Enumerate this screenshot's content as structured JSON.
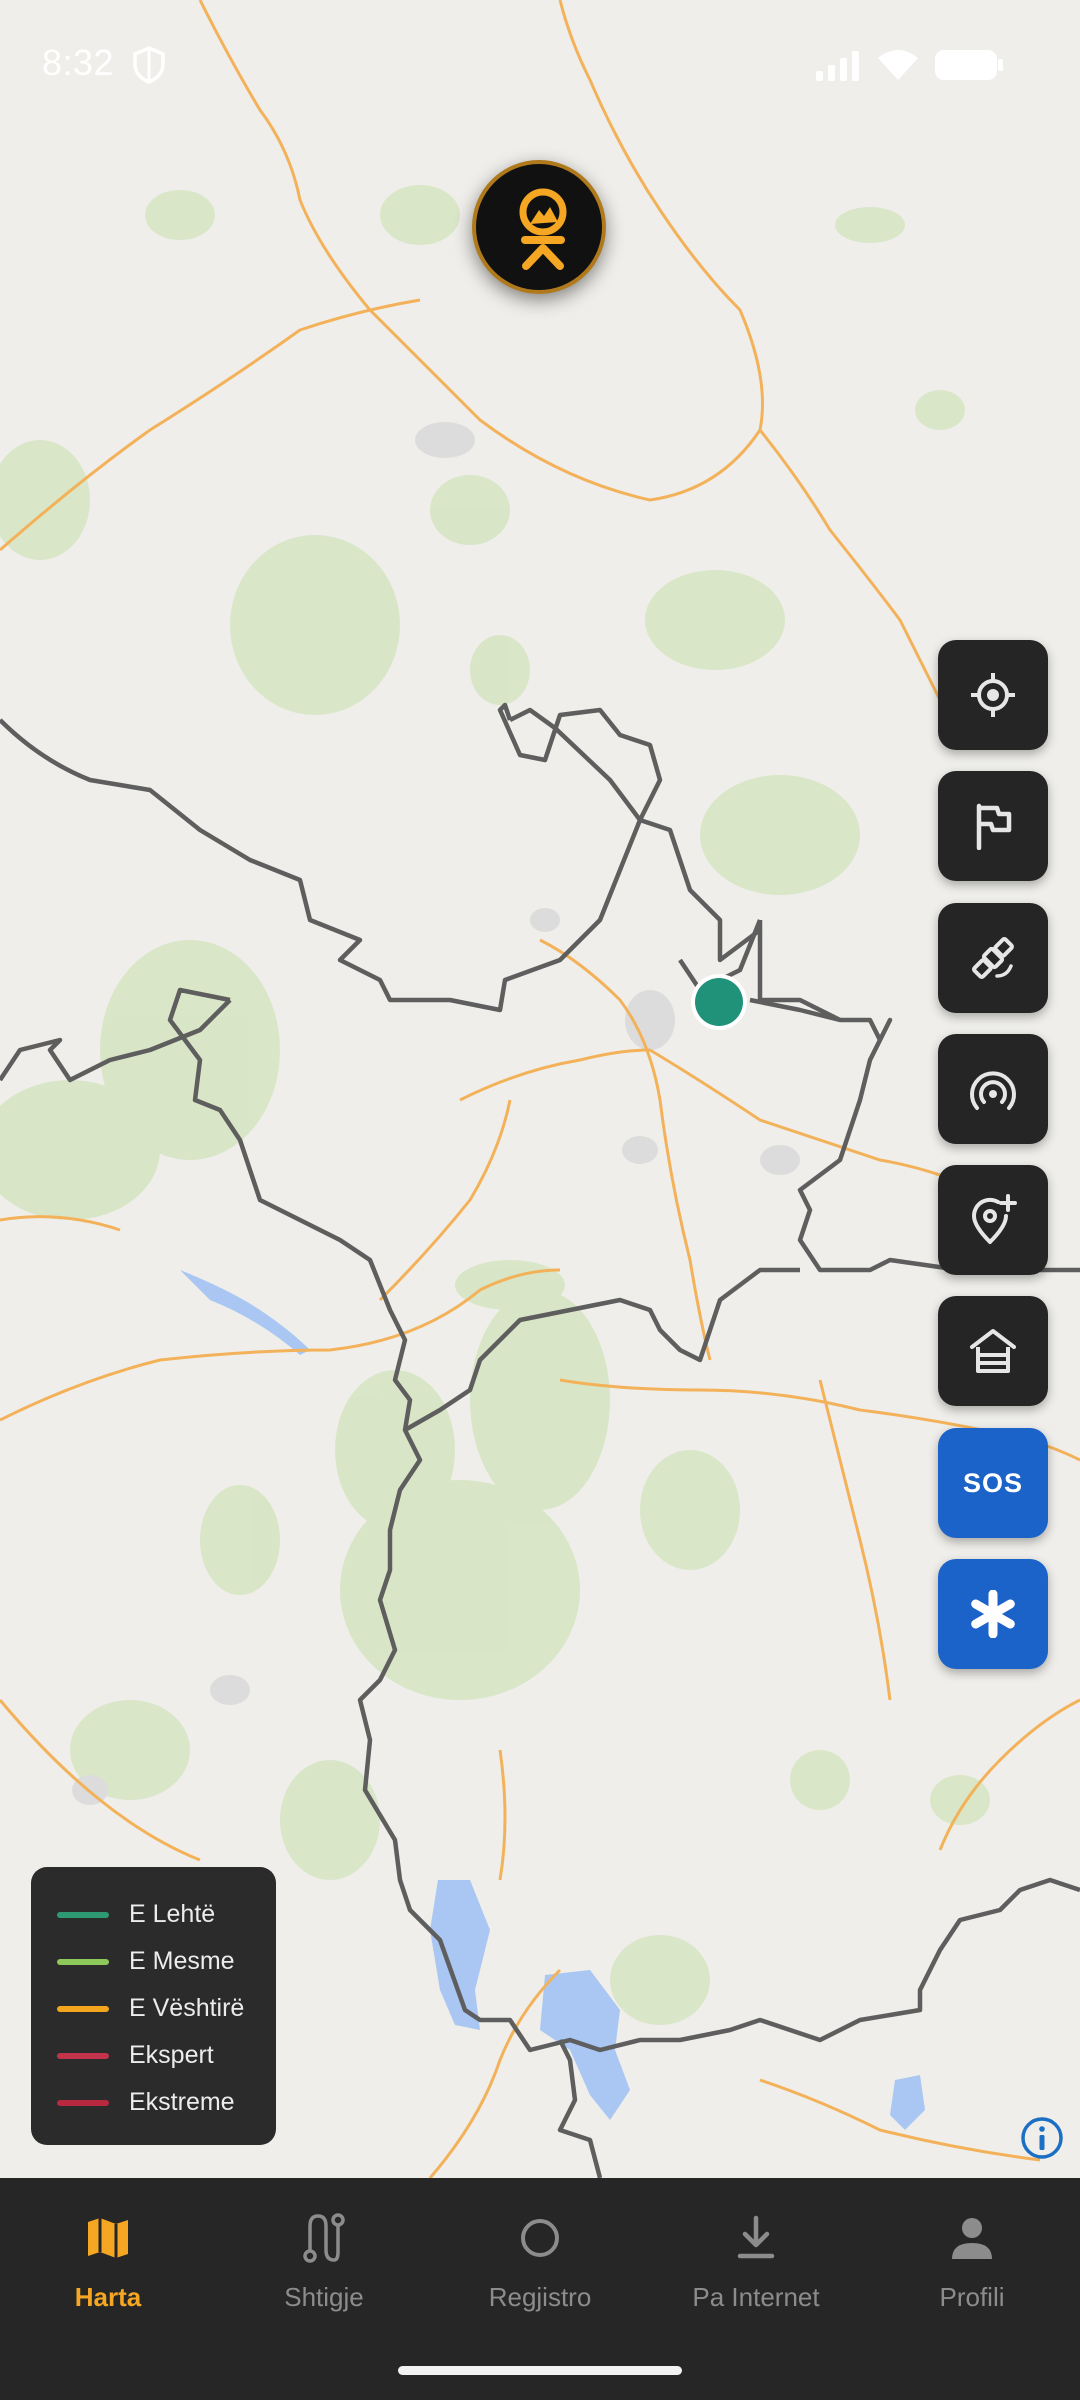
{
  "status_bar": {
    "time": "8:32"
  },
  "legend": {
    "items": [
      {
        "label": "E Lehtë",
        "color": "#2e9a74"
      },
      {
        "label": "E Mesme",
        "color": "#8dc95a"
      },
      {
        "label": "E Vështirë",
        "color": "#f2a51d"
      },
      {
        "label": "Ekspert",
        "color": "#c0334a"
      },
      {
        "label": "Ekstreme",
        "color": "#b8293f"
      }
    ]
  },
  "fabs": {
    "sos_label": "SOS"
  },
  "bottom_nav": {
    "items": [
      {
        "label": "Harta",
        "icon": "map-icon",
        "active": true
      },
      {
        "label": "Shtigje",
        "icon": "route-icon",
        "active": false
      },
      {
        "label": "Regjistro",
        "icon": "record-icon",
        "active": false
      },
      {
        "label": "Pa Internet",
        "icon": "download-icon",
        "active": false
      },
      {
        "label": "Profili",
        "icon": "person-icon",
        "active": false
      }
    ]
  },
  "colors": {
    "accent": "#f5a623",
    "fab_dark": "#252525",
    "fab_blue": "#1b63c8",
    "location_marker": "#1f9279"
  }
}
